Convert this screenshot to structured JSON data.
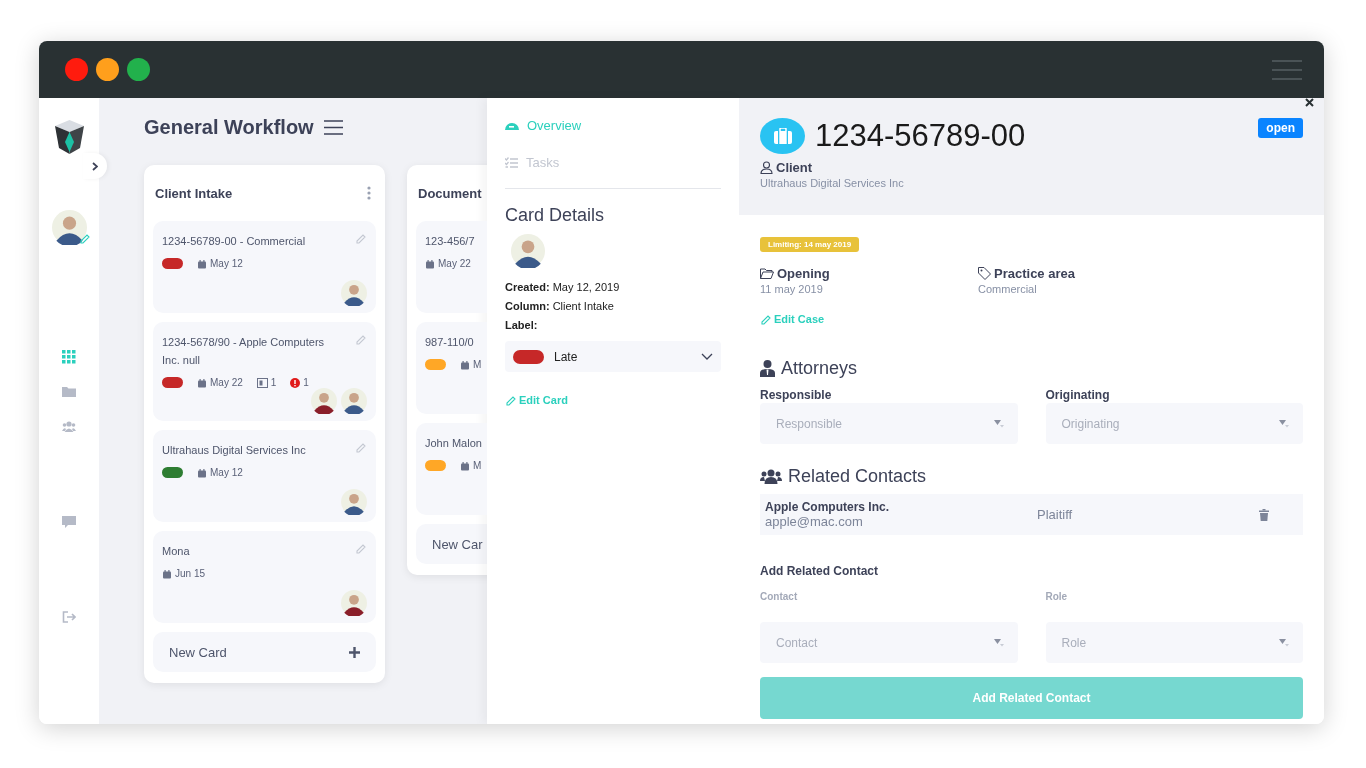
{
  "sidebar": {
    "nav": [
      {
        "kind": "grid",
        "selected": true
      },
      {
        "kind": "folder",
        "selected": false
      },
      {
        "kind": "users",
        "selected": false
      },
      {
        "kind": "chat",
        "selected": false
      },
      {
        "kind": "logout",
        "selected": false
      }
    ]
  },
  "board": {
    "title": "General Workflow",
    "columns": [
      {
        "title": "Client Intake",
        "cards": [
          {
            "title": "1234-56789-00 - Commercial",
            "label": {
              "color": "#c62828"
            },
            "date": "May 12",
            "avatars": [
              {
                "color": "#3b5a8a"
              }
            ]
          },
          {
            "title": "1234-5678/90 - Apple Computers Inc. null",
            "label": {
              "color": "#c62828"
            },
            "date": "May 22",
            "comments": "1",
            "alerts": "1",
            "avatars": [
              {
                "color": "#8a1f2a"
              },
              {
                "color": "#3b5a8a"
              }
            ]
          },
          {
            "title": "Ultrahaus Digital Services Inc",
            "label": {
              "color": "#2e7d32"
            },
            "date": "May 12",
            "avatars": [
              {
                "color": "#3b5a8a"
              }
            ]
          },
          {
            "title": "Mona",
            "date": "Jun 15",
            "avatars": [
              {
                "color": "#8a1f2a"
              }
            ]
          }
        ],
        "new_card": "New Card"
      },
      {
        "title": "Document",
        "cards": [
          {
            "title": "123-456/7",
            "date": "May 22"
          },
          {
            "title": "987-110/0",
            "label": {
              "color": "#ffa726"
            },
            "date": "M"
          },
          {
            "title": "John Malon",
            "label": {
              "color": "#ffa726"
            },
            "date": "M"
          }
        ],
        "new_card": "New Car"
      }
    ]
  },
  "card_panel": {
    "tabs": [
      {
        "label": "Overview",
        "kind": "overview",
        "selected": true
      },
      {
        "label": "Tasks",
        "kind": "tasks",
        "selected": false
      }
    ],
    "heading": "Card Details",
    "avatar": {
      "color": "#3b5a8a"
    },
    "facts": [
      "**Created:** May 12, 2019",
      "**Column:** Client Intake"
    ],
    "label_caption": "Label:",
    "label": {
      "text": "Late",
      "color": "#c62828"
    },
    "edit_link": "Edit Card"
  },
  "case": {
    "number": "1234-56789-00",
    "status": "open",
    "client_label": "Client",
    "client": "Ultrahaus Digital Services Inc",
    "limiting": "Limiting: 14 may 2019",
    "fields": [
      {
        "kind": "folder",
        "label": "Opening",
        "value": "11 may 2019"
      },
      {
        "kind": "tag",
        "label": "Practice area",
        "value": "Commercial"
      }
    ],
    "edit_link": "Edit Case",
    "attorneys": {
      "heading": "Attorneys",
      "selects": [
        {
          "label": "Responsible",
          "placeholder": "Responsible"
        },
        {
          "label": "Originating",
          "placeholder": "Originating"
        }
      ]
    },
    "related": {
      "heading": "Related Contacts",
      "contacts": [
        {
          "name": "Apple Computers Inc.",
          "email": "apple@mac.com",
          "role": "Plaitiff"
        }
      ]
    },
    "add_contact": {
      "heading": "Add Related Contact",
      "selects": [
        {
          "label": "Contact",
          "placeholder": "Contact"
        },
        {
          "label": "Role",
          "placeholder": "Role"
        }
      ],
      "button": "Add Related Contact"
    }
  }
}
